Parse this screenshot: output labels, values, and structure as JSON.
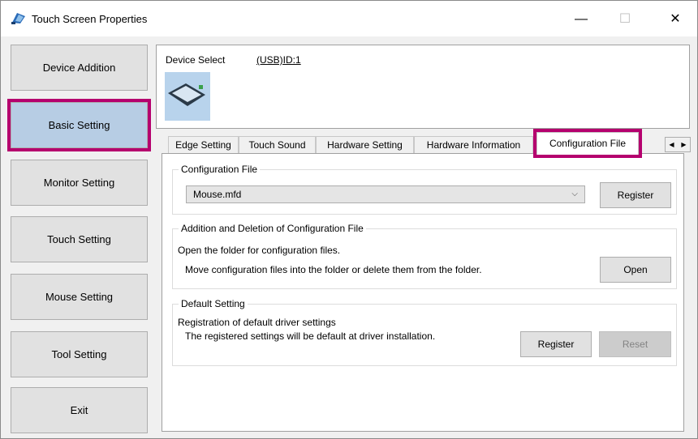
{
  "window": {
    "title": "Touch Screen Properties",
    "controls": {
      "minimize": "—",
      "maximize": "☐",
      "close": "✕"
    }
  },
  "nav": {
    "items": [
      {
        "label": "Device Addition"
      },
      {
        "label": "Basic Setting",
        "active": true
      },
      {
        "label": "Monitor Setting"
      },
      {
        "label": "Touch Setting"
      },
      {
        "label": "Mouse Setting"
      },
      {
        "label": "Tool Setting"
      },
      {
        "label": "Exit"
      }
    ]
  },
  "device": {
    "label": "Device Select",
    "value": "(USB)ID:1"
  },
  "tabs": [
    {
      "label": "Edge Setting"
    },
    {
      "label": "Touch Sound"
    },
    {
      "label": "Hardware Setting"
    },
    {
      "label": "Hardware Information"
    },
    {
      "label": "Configuration File",
      "active": true
    }
  ],
  "tab_scroll": {
    "left": "◀",
    "right": "▶"
  },
  "config_file_group": {
    "title": "Configuration File",
    "selected": "Mouse.mfd",
    "register_label": "Register"
  },
  "add_delete_group": {
    "title": "Addition and Deletion of Configuration File",
    "line1": "Open the folder for configuration files.",
    "line2": "Move configuration files into the folder or delete them from the folder.",
    "open_label": "Open"
  },
  "default_group": {
    "title": "Default Setting",
    "line1": "Registration of default driver settings",
    "line2": "The registered settings will be default at driver installation.",
    "register_label": "Register",
    "reset_label": "Reset"
  },
  "colors": {
    "highlight": "#b5006e",
    "active_nav": "#b7cde4"
  }
}
